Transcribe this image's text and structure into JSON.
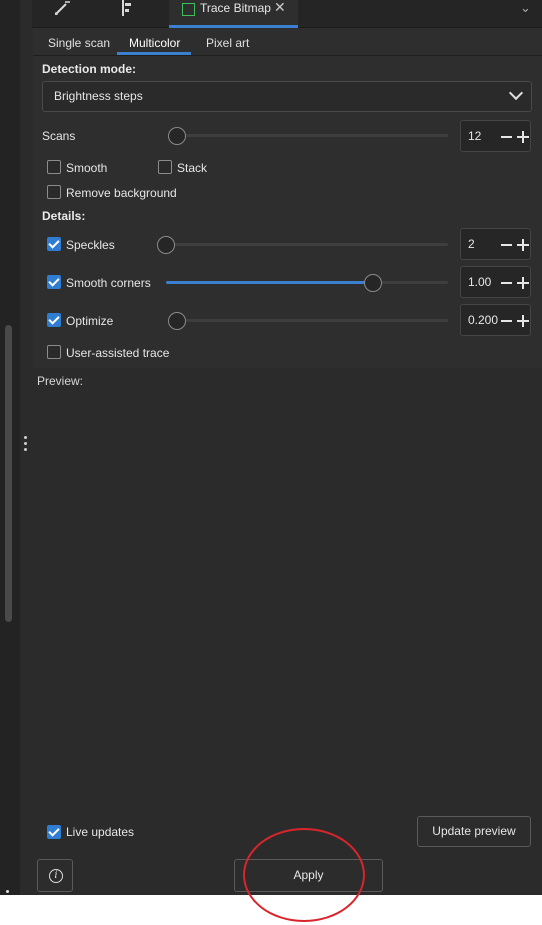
{
  "tabs": {
    "active_title": "Trace Bitmap",
    "close_glyph": "✕",
    "menu_glyph": "⌄"
  },
  "subtabs": [
    "Single scan",
    "Multicolor",
    "Pixel art"
  ],
  "detection": {
    "label": "Detection mode:",
    "value": "Brightness steps"
  },
  "scans": {
    "label": "Scans",
    "value": "12",
    "level": 0.0
  },
  "options": {
    "smooth": {
      "label": "Smooth",
      "checked": false
    },
    "stack": {
      "label": "Stack",
      "checked": false
    },
    "remove_background": {
      "label": "Remove background",
      "checked": false
    }
  },
  "details": {
    "label": "Details:",
    "speckles": {
      "label": "Speckles",
      "checked": true,
      "value": "2",
      "level": 0.0
    },
    "smooth_corners": {
      "label": "Smooth corners",
      "checked": true,
      "value": "1.00",
      "level": 0.75
    },
    "optimize": {
      "label": "Optimize",
      "checked": true,
      "value": "0.200",
      "level": 0.0
    },
    "user_assisted": {
      "label": "User-assisted trace",
      "checked": false
    }
  },
  "preview": {
    "label": "Preview:"
  },
  "footer": {
    "live_updates": {
      "label": "Live updates",
      "checked": true
    },
    "update_preview": "Update preview",
    "apply": "Apply",
    "info_glyph": "i"
  },
  "colors": {
    "accent": "#3b7fd0",
    "annotation": "#d9252b",
    "panel_bg": "#2e2e2e",
    "trace_icon": "#3fbf5a"
  }
}
